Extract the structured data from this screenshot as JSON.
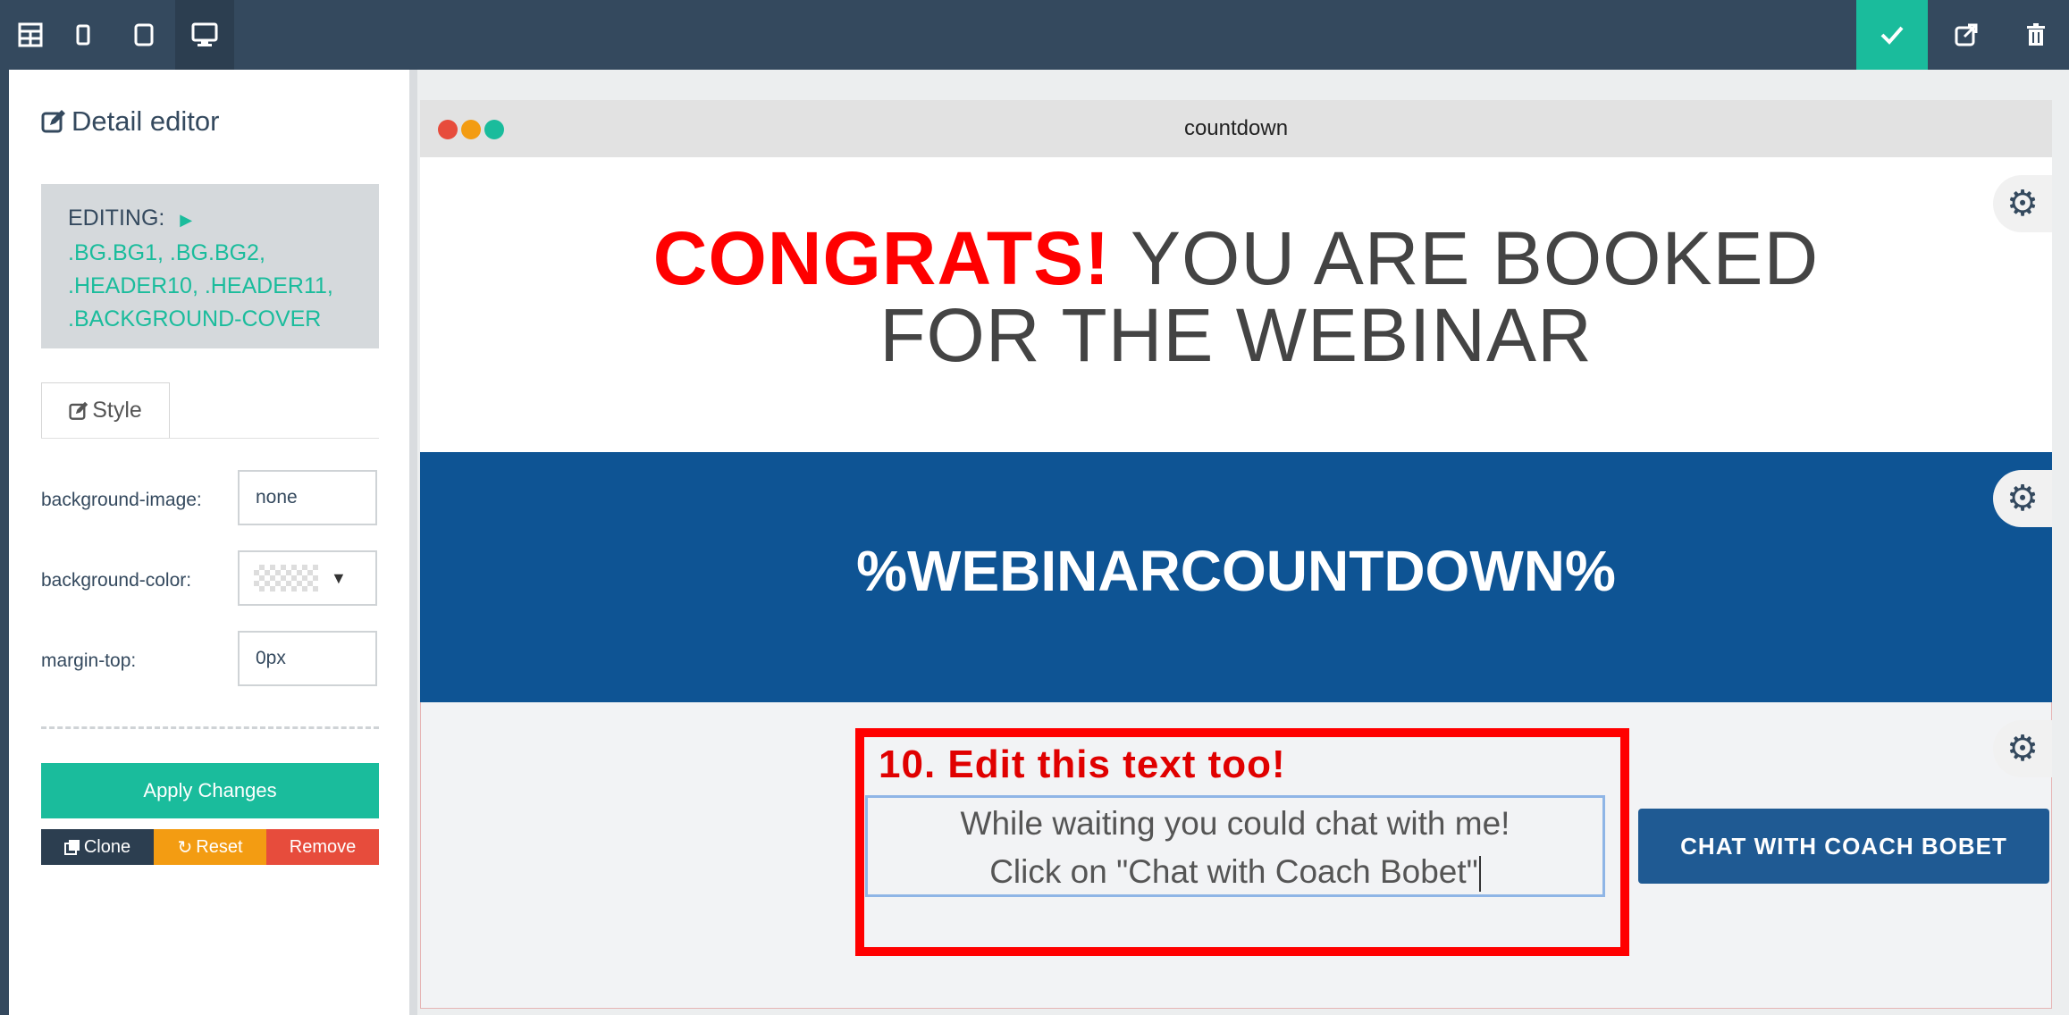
{
  "toolbar": {
    "view_buttons": [
      "grid-view",
      "mobile-view",
      "tablet-view",
      "desktop-view"
    ],
    "active_view": "desktop-view",
    "actions": [
      "check-icon",
      "external-link-icon",
      "trash-icon"
    ],
    "colors": {
      "bar": "#34495e",
      "active": "#2c3e50",
      "confirm": "#1abc9c"
    }
  },
  "sidebar": {
    "title": "Detail editor",
    "editing_label": "EDITING:",
    "editing_classes": [
      ".BG.BG1, .BG.BG2,",
      ".HEADER10, .HEADER11,",
      ".BACKGROUND-COVER"
    ],
    "tab_label": "Style",
    "props": [
      {
        "label": "background-image:",
        "value": "none"
      },
      {
        "label": "background-color:",
        "value": ""
      },
      {
        "label": "margin-top:",
        "value": "0px"
      }
    ],
    "apply_label": "Apply Changes",
    "clone_label": "Clone",
    "reset_label": "Reset",
    "remove_label": "Remove"
  },
  "preview": {
    "window_title": "countdown",
    "headline_red": "CONGRATS!",
    "headline_rest_1": " YOU ARE BOOKED",
    "headline_line_2": "FOR THE WEBINAR",
    "countdown": "%WEBINARCOUNTDOWN%",
    "annotation": "10. Edit this text too!",
    "edit_line_1": "While waiting you could chat with me!",
    "edit_line_2": "Click on \"Chat with Coach Bobet\"",
    "chat_button": "CHAT WITH COACH BOBET",
    "colors": {
      "blue_section": "#0e5494",
      "headline_red": "#ff0000",
      "button": "#1f5a93"
    }
  }
}
